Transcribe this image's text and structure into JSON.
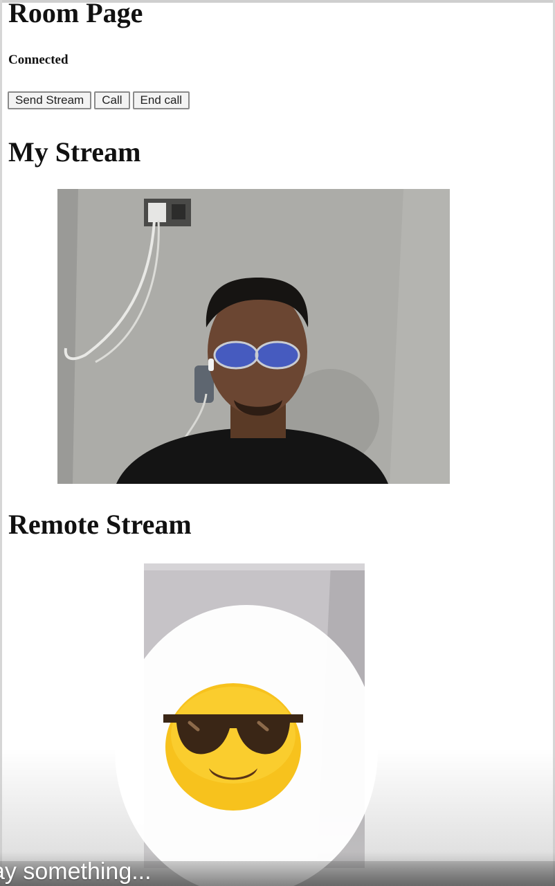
{
  "page": {
    "title": "Room Page",
    "status": "Connected"
  },
  "controls": {
    "send_stream_label": "Send Stream",
    "call_label": "Call",
    "end_call_label": "End call"
  },
  "sections": {
    "my_stream_title": "My Stream",
    "remote_stream_title": "Remote Stream"
  },
  "overlay": {
    "emoji_icon": "smiling-face-with-sunglasses-icon",
    "comment_placeholder": "ay something..."
  },
  "colors": {
    "background": "#ffffff",
    "emoji_yellow": "#f7c21d",
    "sunglasses": "#3a2616"
  }
}
